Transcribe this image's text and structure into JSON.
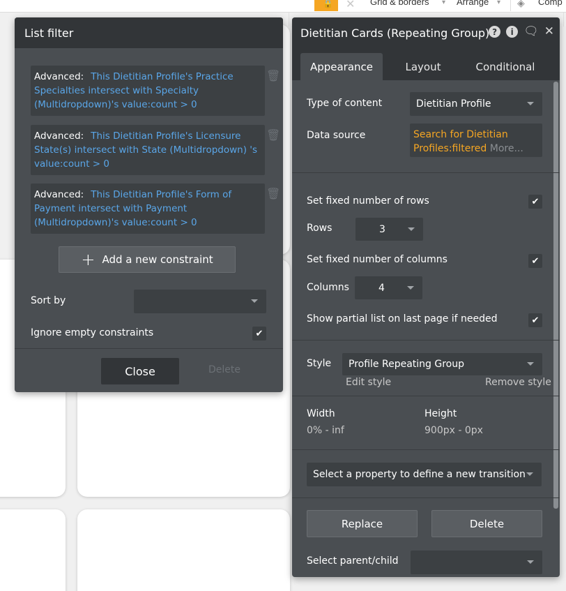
{
  "topbar": {
    "grid_label": "Grid & borders",
    "arrange_label": "Arrange",
    "comp_label": "Comp"
  },
  "list_filter": {
    "title": "List filter",
    "constraints": [
      {
        "prefix": "Advanced:",
        "expr": "This Dietitian Profile's Practice Specialties intersect with Specialty (Multidropdown)'s value:count > 0"
      },
      {
        "prefix": "Advanced:",
        "expr": "This Dietitian Profile's Licensure State(s) intersect with State (Multidropdown) 's value:count > 0"
      },
      {
        "prefix": "Advanced:",
        "expr": "This Dietitian Profile's Form of Payment intersect with Payment (Multidropdown)'s value:count > 0"
      }
    ],
    "add_constraint_label": "Add a new constraint",
    "sort_by_label": "Sort by",
    "sort_by_value": "",
    "ignore_empty_label": "Ignore empty constraints",
    "ignore_empty_checked": true,
    "close_label": "Close",
    "delete_label": "Delete"
  },
  "prop_editor": {
    "title": "Dietitian Cards (Repeating Group)",
    "tabs": [
      {
        "label": "Appearance",
        "active": true
      },
      {
        "label": "Layout",
        "active": false
      },
      {
        "label": "Conditional",
        "active": false
      }
    ],
    "type_of_content_label": "Type of content",
    "type_of_content_value": "Dietitian Profile",
    "data_source_label": "Data source",
    "data_source_value_line1": "Search for Dietitian",
    "data_source_value_line2": "Profiles:filtered",
    "data_source_more": "More...",
    "fixed_rows_label": "Set fixed number of rows",
    "rows_label": "Rows",
    "rows_value": "3",
    "fixed_cols_label": "Set fixed number of columns",
    "cols_label": "Columns",
    "cols_value": "4",
    "partial_list_label": "Show partial list on last page if needed",
    "style_label": "Style",
    "style_value": "Profile Repeating Group",
    "edit_style_label": "Edit style",
    "remove_style_label": "Remove style",
    "width_label": "Width",
    "width_value": "0% - inf",
    "height_label": "Height",
    "height_value": "900px - 0px",
    "transition_placeholder": "Select a property to define a new transition",
    "replace_label": "Replace",
    "delete_label": "Delete",
    "select_parent_label": "Select parent/child",
    "select_parent_value": ""
  },
  "colors": {
    "panel_bg": "#4a4e52",
    "header_bg": "#323538",
    "field_bg": "#3c4043",
    "link_blue": "#5aa6e8",
    "orange": "#f5a623"
  }
}
